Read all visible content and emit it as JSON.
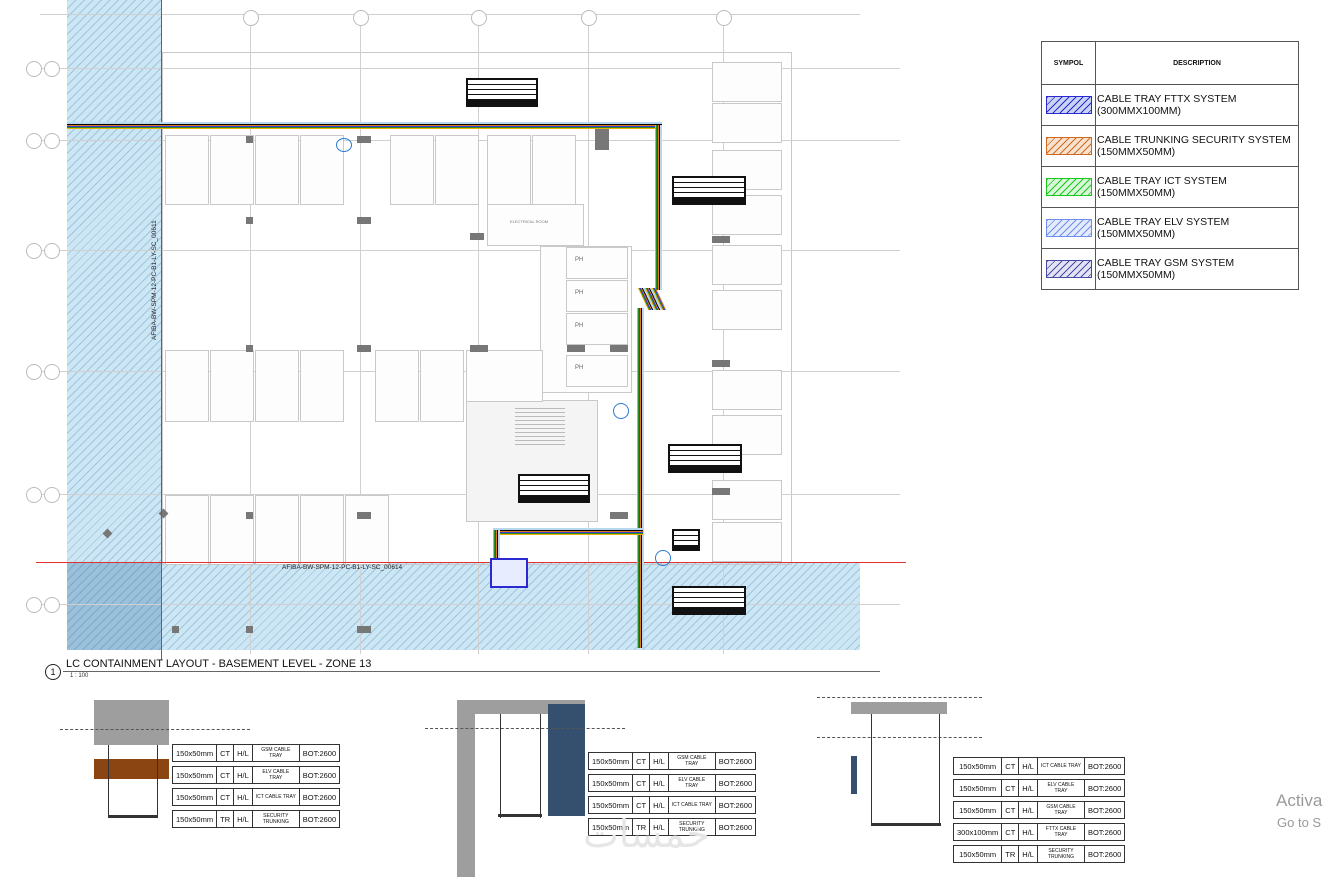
{
  "plan": {
    "tag_top_vertical": "AFIBA-BW-SPM-12-PC-B1-LY-SC_00611",
    "tag_bottom": "AFIBA-BW-SPM-12-PC-B1-LY-SC_00614",
    "view_number": "1",
    "view_title": "LC CONTAINMENT LAYOUT - BASEMENT LEVEL - ZONE 13",
    "scale": "1 : 100",
    "room_label": "ELECTRICAL ROOM",
    "ph_labels": [
      "PH",
      "PH",
      "PH",
      "PH"
    ]
  },
  "legend": {
    "header_symbol": "SYMPOL",
    "header_description": "DESCRIPTION",
    "items": [
      {
        "line1": "CABLE TRAY FTTX SYSTEM",
        "line2": "(300MMX100MM)",
        "color": "#2a2ad0",
        "fill": "#c9d4f5"
      },
      {
        "line1": "CABLE TRUNKING SECURITY SYSTEM",
        "line2": "(150MMX50MM)",
        "color": "#d2691e",
        "fill": "#f7e2cf"
      },
      {
        "line1": "CABLE TRAY ICT SYSTEM",
        "line2": "(150MMX50MM)",
        "color": "#19c919",
        "fill": "#d9f7d9"
      },
      {
        "line1": "CABLE TRAY ELV SYSTEM",
        "line2": "(150MMX50MM)",
        "color": "#6f8ff0",
        "fill": "#e4ebfc"
      },
      {
        "line1": "CABLE TRAY GSM SYSTEM",
        "line2": "(150MMX50MM)",
        "color": "#4a4aa8",
        "fill": "#e3e3f4"
      }
    ]
  },
  "sections": [
    {
      "rows": [
        [
          "150x50mm",
          "CT",
          "H/L",
          "GSM CABLE TRAY",
          "BOT:2600"
        ],
        [
          "150x50mm",
          "CT",
          "H/L",
          "ELV CABLE TRAY",
          "BOT:2600"
        ],
        [
          "150x50mm",
          "CT",
          "H/L",
          "ICT CABLE TRAY",
          "BOT:2600"
        ],
        [
          "150x50mm",
          "TR",
          "H/L",
          "SECURITY TRUNKING",
          "BOT:2600"
        ]
      ]
    },
    {
      "rows": [
        [
          "150x50mm",
          "CT",
          "H/L",
          "GSM CABLE TRAY",
          "BOT:2600"
        ],
        [
          "150x50mm",
          "CT",
          "H/L",
          "ELV CABLE TRAY",
          "BOT:2600"
        ],
        [
          "150x50mm",
          "CT",
          "H/L",
          "ICT CABLE TRAY",
          "BOT:2600"
        ],
        [
          "150x50mm",
          "TR",
          "H/L",
          "SECURITY TRUNKING",
          "BOT:2600"
        ]
      ]
    },
    {
      "rows": [
        [
          "150x50mm",
          "CT",
          "H/L",
          "ICT CABLE TRAY",
          "BOT:2600"
        ],
        [
          "150x50mm",
          "CT",
          "H/L",
          "ELV CABLE TRAY",
          "BOT:2600"
        ],
        [
          "150x50mm",
          "CT",
          "H/L",
          "GSM CABLE TRAY",
          "BOT:2600"
        ],
        [
          "300x100mm",
          "CT",
          "H/L",
          "FTTX CABLE TRAY",
          "BOT:2600"
        ],
        [
          "150x50mm",
          "TR",
          "H/L",
          "SECURITY TRUNKING",
          "BOT:2600"
        ]
      ]
    }
  ],
  "overlay": {
    "activate_line1": "Activa",
    "activate_line2": "Go to S",
    "watermark": "خمسات"
  }
}
